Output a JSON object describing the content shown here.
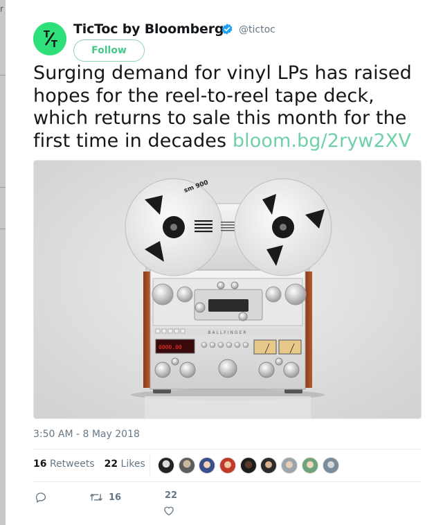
{
  "window": {
    "edge_fragment": "r"
  },
  "tweet": {
    "author": {
      "name": "TicToc by Bloomberg",
      "handle": "@tictoc",
      "verified": true,
      "avatar_glyph": "T/T",
      "avatar_color": "#2fe07a"
    },
    "follow_label": "Follow",
    "text": "Surging demand for vinyl LPs has raised hopes for the reel-to-reel tape deck, which returns to sale this month for the first time in decades ",
    "link": "bloom.bg/2ryw2XV",
    "media": {
      "description": "Ballfinger M 063 reel-to-reel tape deck",
      "reel_label": "sm 900",
      "brand_label": "BALLFINGER",
      "counter_display": "0000.00"
    },
    "timestamp": "3:50 AM - 8 May 2018",
    "stats": {
      "retweets_count": "16",
      "retweets_label": "Retweets",
      "likes_count": "22",
      "likes_label": "Likes"
    },
    "actions": {
      "reply_count": "",
      "retweet_count": "16",
      "like_count": "22"
    },
    "colors": {
      "accent": "#47c88a",
      "link": "#6fd0a8",
      "muted": "#657786",
      "verified": "#1da1f2"
    }
  }
}
